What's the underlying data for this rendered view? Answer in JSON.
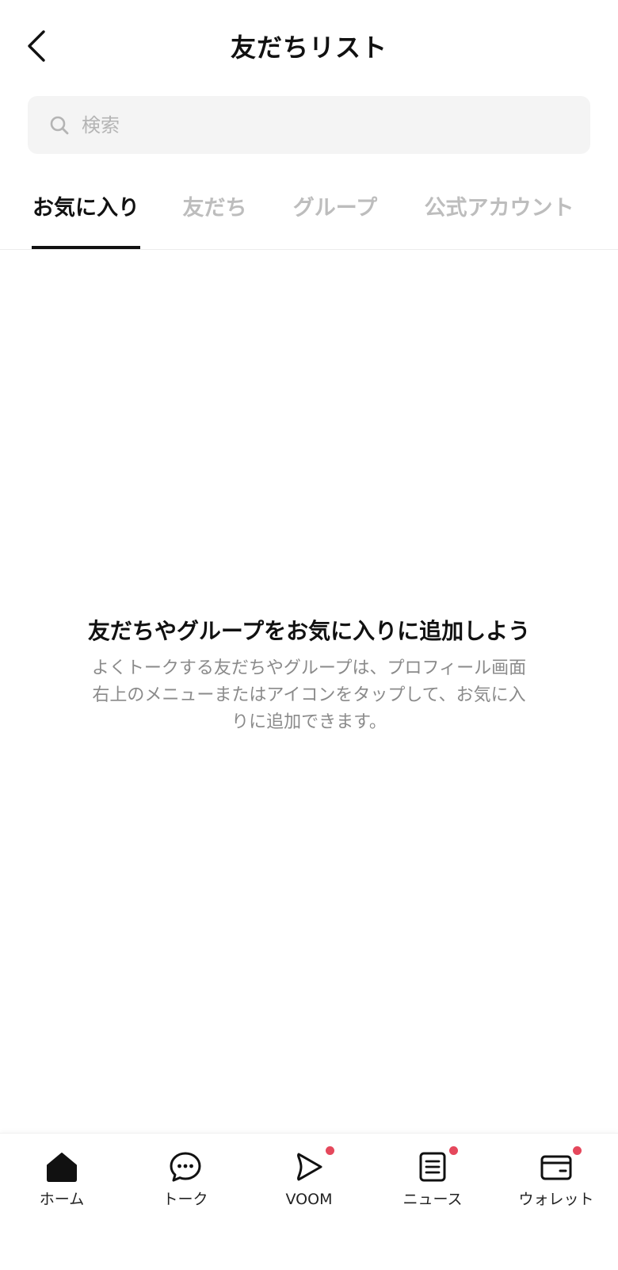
{
  "header": {
    "title": "友だちリスト"
  },
  "search": {
    "placeholder": "検索",
    "value": ""
  },
  "tabs": [
    {
      "label": "お気に入り",
      "active": true
    },
    {
      "label": "友だち",
      "active": false
    },
    {
      "label": "グループ",
      "active": false
    },
    {
      "label": "公式アカウント",
      "active": false
    }
  ],
  "empty_state": {
    "title": "友だちやグループをお気に入りに追加しよう",
    "description": "よくトークする友だちやグループは、プロフィール画面右上のメニューまたはアイコンをタップして、お気に入りに追加できます。"
  },
  "bottom_nav": {
    "items": [
      {
        "label": "ホーム",
        "icon": "home-icon",
        "badge": false
      },
      {
        "label": "トーク",
        "icon": "chat-bubble-icon",
        "badge": false
      },
      {
        "label": "VOOM",
        "icon": "voom-play-icon",
        "badge": true
      },
      {
        "label": "ニュース",
        "icon": "news-icon",
        "badge": true
      },
      {
        "label": "ウォレット",
        "icon": "wallet-icon",
        "badge": true
      }
    ]
  },
  "colors": {
    "text_primary": "#111111",
    "tab_inactive": "#bdbdbd",
    "search_bg": "#f4f4f4",
    "badge": "#e5485c"
  }
}
